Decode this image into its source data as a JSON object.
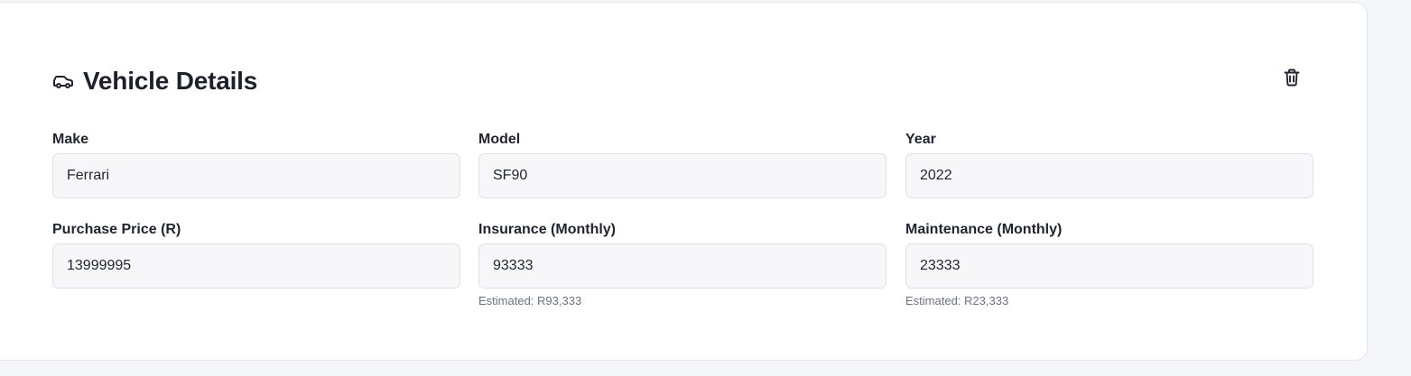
{
  "section": {
    "title": "Vehicle Details",
    "icon": "car-icon",
    "delete_icon": "trash-icon"
  },
  "fields": {
    "make": {
      "label": "Make",
      "value": "Ferrari"
    },
    "model": {
      "label": "Model",
      "value": "SF90"
    },
    "year": {
      "label": "Year",
      "value": "2022"
    },
    "purchase_price": {
      "label": "Purchase Price (R)",
      "value": "13999995"
    },
    "insurance": {
      "label": "Insurance (Monthly)",
      "value": "93333",
      "hint": "Estimated: R93,333"
    },
    "maintenance": {
      "label": "Maintenance (Monthly)",
      "value": "23333",
      "hint": "Estimated: R23,333"
    }
  },
  "colors": {
    "background": "#f5f6f9",
    "card": "#ffffff",
    "input_bg": "#f7f7fa",
    "input_border": "#dfe1e7",
    "text": "#1f2430",
    "hint": "#6b7280"
  }
}
